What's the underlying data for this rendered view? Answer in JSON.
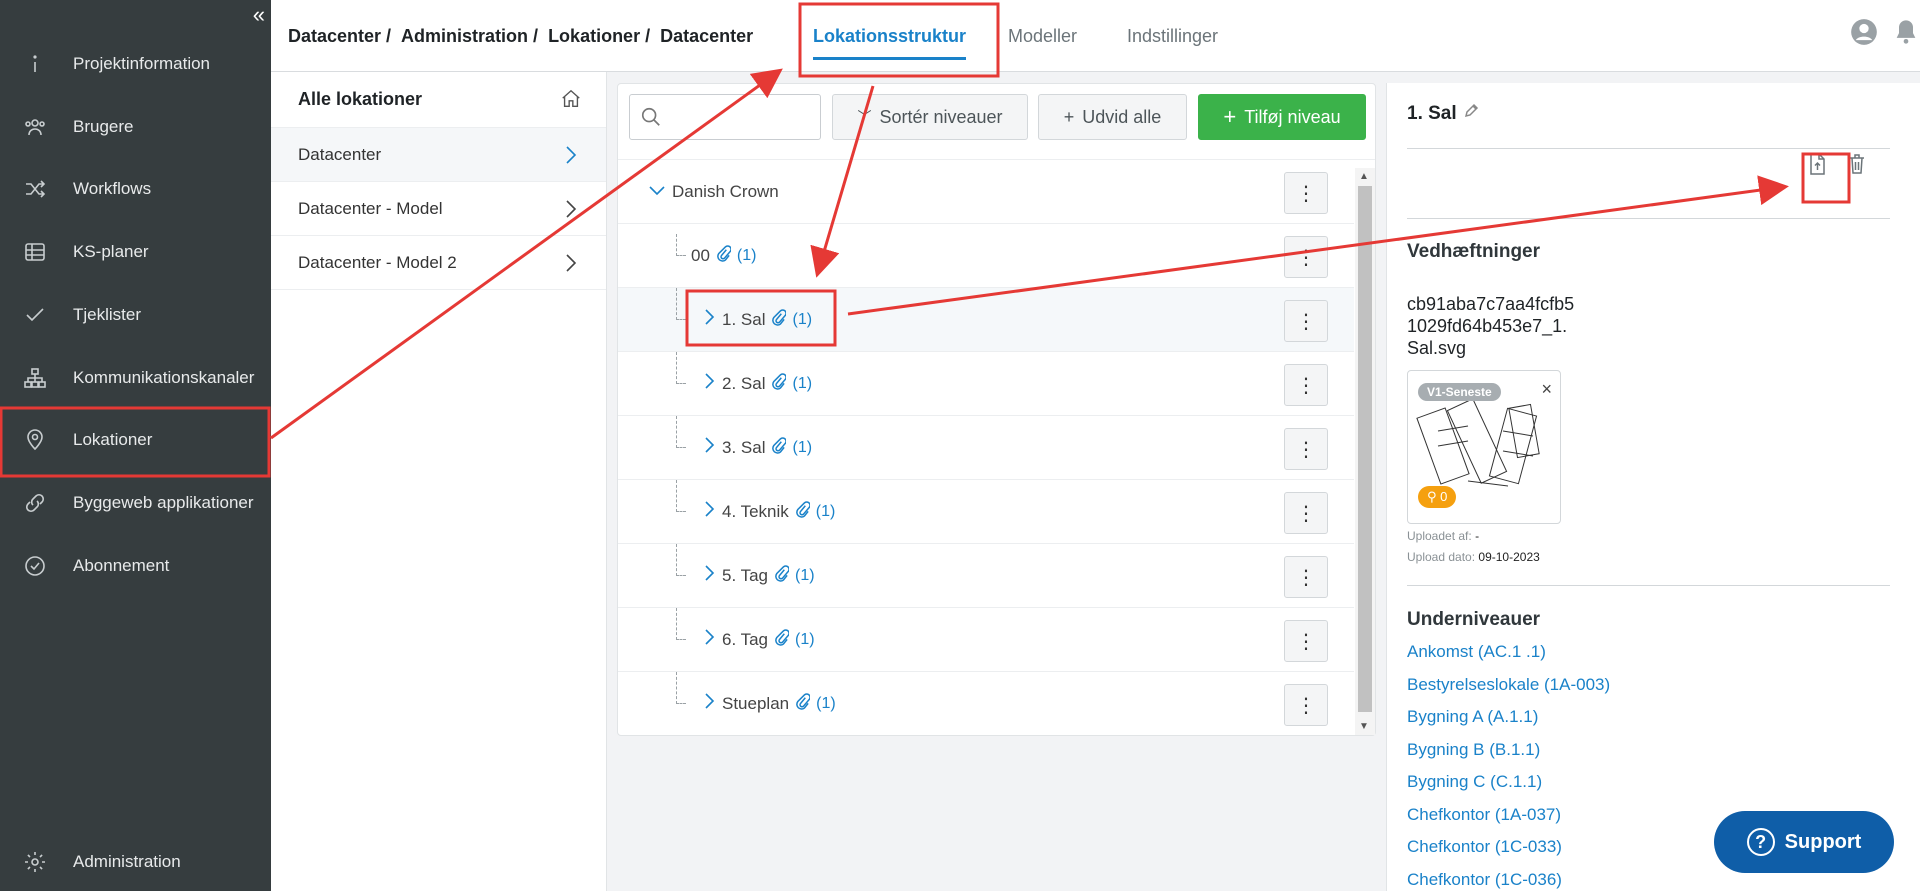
{
  "sidebar": {
    "collapse_icon": "double-chevron-left-icon",
    "items": [
      {
        "label": "Projektinformation",
        "icon": "info-icon"
      },
      {
        "label": "Brugere",
        "icon": "users-icon"
      },
      {
        "label": "Workflows",
        "icon": "shuffle-icon"
      },
      {
        "label": "KS-planer",
        "icon": "table-icon"
      },
      {
        "label": "Tjeklister",
        "icon": "check-icon"
      },
      {
        "label": "Kommunikationskanaler",
        "icon": "hierarchy-icon"
      },
      {
        "label": "Lokationer",
        "icon": "location-pin-icon"
      },
      {
        "label": "Byggeweb applikationer",
        "icon": "link-icon"
      },
      {
        "label": "Abonnement",
        "icon": "badge-check-icon"
      }
    ],
    "bottom_item": {
      "label": "Administration",
      "icon": "gear-icon"
    }
  },
  "header": {
    "breadcrumb": [
      "Datacenter /",
      "Administration /",
      "Lokationer /",
      "Datacenter"
    ],
    "tabs": [
      "Lokationsstruktur",
      "Modeller",
      "Indstillinger"
    ],
    "active_tab": "Lokationsstruktur"
  },
  "locations": {
    "title": "Alle lokationer",
    "items": [
      "Datacenter",
      "Datacenter - Model",
      "Datacenter - Model 2"
    ]
  },
  "tree": {
    "search_placeholder": "",
    "sort_label": "Sortér niveauer",
    "expand_label": "Udvid alle",
    "add_label": "Tilføj niveau",
    "root": "Danish Crown",
    "kebab": "⋮",
    "rows": [
      {
        "label": "00",
        "count": "(1)"
      },
      {
        "label": "1. Sal",
        "count": "(1)"
      },
      {
        "label": "2. Sal",
        "count": "(1)"
      },
      {
        "label": "3. Sal",
        "count": "(1)"
      },
      {
        "label": "4. Teknik",
        "count": "(1)"
      },
      {
        "label": "5. Tag",
        "count": "(1)"
      },
      {
        "label": "6. Tag",
        "count": "(1)"
      },
      {
        "label": "Stueplan",
        "count": "(1)"
      }
    ]
  },
  "detail": {
    "title": "1. Sal",
    "attachments_heading": "Vedhæftninger",
    "file_name": "cb91aba7c7aa4fcfb51029fd64b453e7_1.Sal.svg",
    "version_badge": "V1-Seneste",
    "pin_count": "0",
    "uploaded_by_label": "Uploadet af:",
    "uploaded_by": "-",
    "upload_date_label": "Upload dato:",
    "upload_date": "09-10-2023",
    "sublevels_heading": "Underniveauer",
    "sublevels": [
      "Ankomst (AC.1 .1)",
      "Bestyrelseslokale (1A-003)",
      "Bygning A (A.1.1)",
      "Bygning B (B.1.1)",
      "Bygning C (C.1.1)",
      "Chefkontor (1A-037)",
      "Chefkontor (1C-033)",
      "Chefkontor (1C-036)"
    ]
  },
  "support": {
    "label": "Support"
  },
  "colors": {
    "sidebar": "#363d3f",
    "accent": "#1a82c9",
    "green": "#3bb24a",
    "annotation": "#e53935"
  }
}
